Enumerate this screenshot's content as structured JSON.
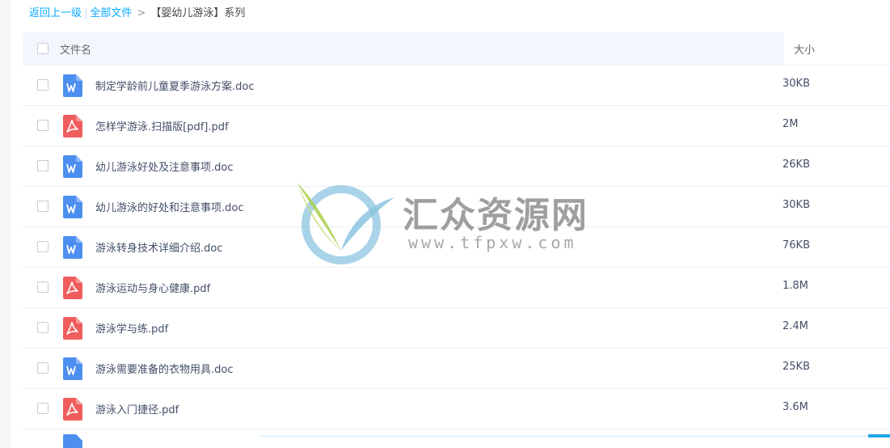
{
  "breadcrumb": {
    "back": "返回上一级",
    "separator": "|",
    "all_files": "全部文件",
    "arrow": ">",
    "current": "【婴幼儿游泳】系列"
  },
  "list_header": {
    "name": "文件名",
    "size": "大小"
  },
  "files": [
    {
      "icon": "word-doc-icon",
      "name": "制定学龄前儿童夏季游泳方案.doc",
      "size": "30KB"
    },
    {
      "icon": "pdf-icon",
      "name": "怎样学游泳.扫描版[pdf].pdf",
      "size": "2M"
    },
    {
      "icon": "word-doc-icon",
      "name": "幼儿游泳好处及注意事项.doc",
      "size": "26KB"
    },
    {
      "icon": "word-doc-icon",
      "name": "幼儿游泳的好处和注意事项.doc",
      "size": "30KB"
    },
    {
      "icon": "word-doc-icon",
      "name": "游泳转身技术详细介绍.doc",
      "size": "76KB"
    },
    {
      "icon": "pdf-icon",
      "name": "游泳运动与身心健康.pdf",
      "size": "1.8M"
    },
    {
      "icon": "pdf-icon",
      "name": "游泳学与练.pdf",
      "size": "2.4M"
    },
    {
      "icon": "word-doc-icon",
      "name": "游泳需要准备的衣物用具.doc",
      "size": "25KB"
    },
    {
      "icon": "pdf-icon",
      "name": "游泳入门捷径.pdf",
      "size": "3.6M"
    }
  ],
  "watermark": {
    "title": "汇众资源网",
    "url": "www.tfpxw.com"
  },
  "colors": {
    "link": "#09aaff",
    "word_icon": "#4d8ff0",
    "pdf_icon": "#f05d5d",
    "header_bg": "#f3f7fd",
    "text": "#424e67"
  }
}
